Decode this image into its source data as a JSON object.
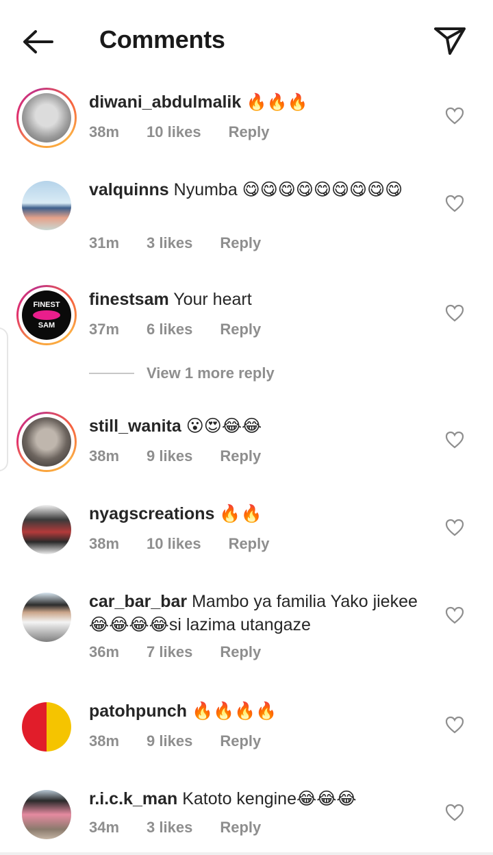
{
  "header": {
    "title": "Comments",
    "back_icon": "arrow-left-icon",
    "share_icon": "send-paper-plane-icon"
  },
  "comments": [
    {
      "username": "diwani_abdulmalik",
      "text": " 🔥🔥🔥",
      "time": "38m",
      "likes": "10 likes",
      "reply": "Reply",
      "avatar_ring": true
    },
    {
      "username": "valquinns",
      "text": " Nyumba 😋😋😋😋😋😋😋😋😋",
      "time": "31m",
      "likes": "3 likes",
      "reply": "Reply",
      "avatar_ring": false
    },
    {
      "username": "finestsam",
      "text": " Your heart",
      "time": "37m",
      "likes": "6 likes",
      "reply": "Reply",
      "avatar_ring": true,
      "avatar_logo": {
        "top": "FINEST",
        "bottom": "SAM"
      }
    },
    {
      "username": "still_wanita",
      "text": " 😮😍😂😂",
      "time": "38m",
      "likes": "9 likes",
      "reply": "Reply",
      "avatar_ring": true
    },
    {
      "username": "nyagscreations",
      "text": " 🔥🔥",
      "time": "38m",
      "likes": "10 likes",
      "reply": "Reply",
      "avatar_ring": false
    },
    {
      "username": "car_bar_bar",
      "text": " Mambo ya familia Yako jiekee😂😂😂😂si lazima utangaze",
      "time": "36m",
      "likes": "7 likes",
      "reply": "Reply",
      "avatar_ring": false
    },
    {
      "username": "patohpunch",
      "text": " 🔥🔥🔥🔥",
      "time": "38m",
      "likes": "9 likes",
      "reply": "Reply",
      "avatar_ring": false
    },
    {
      "username": "r.i.c.k_man",
      "text": " Katoto kengine😂😂😂",
      "time": "34m",
      "likes": "3 likes",
      "reply": "Reply",
      "avatar_ring": false
    }
  ],
  "view_more": {
    "label": "View 1 more reply"
  },
  "colors": {
    "text": "#262626",
    "meta": "#8e8e8e",
    "ring_start": "#f9a13a",
    "ring_end": "#e1306c"
  }
}
